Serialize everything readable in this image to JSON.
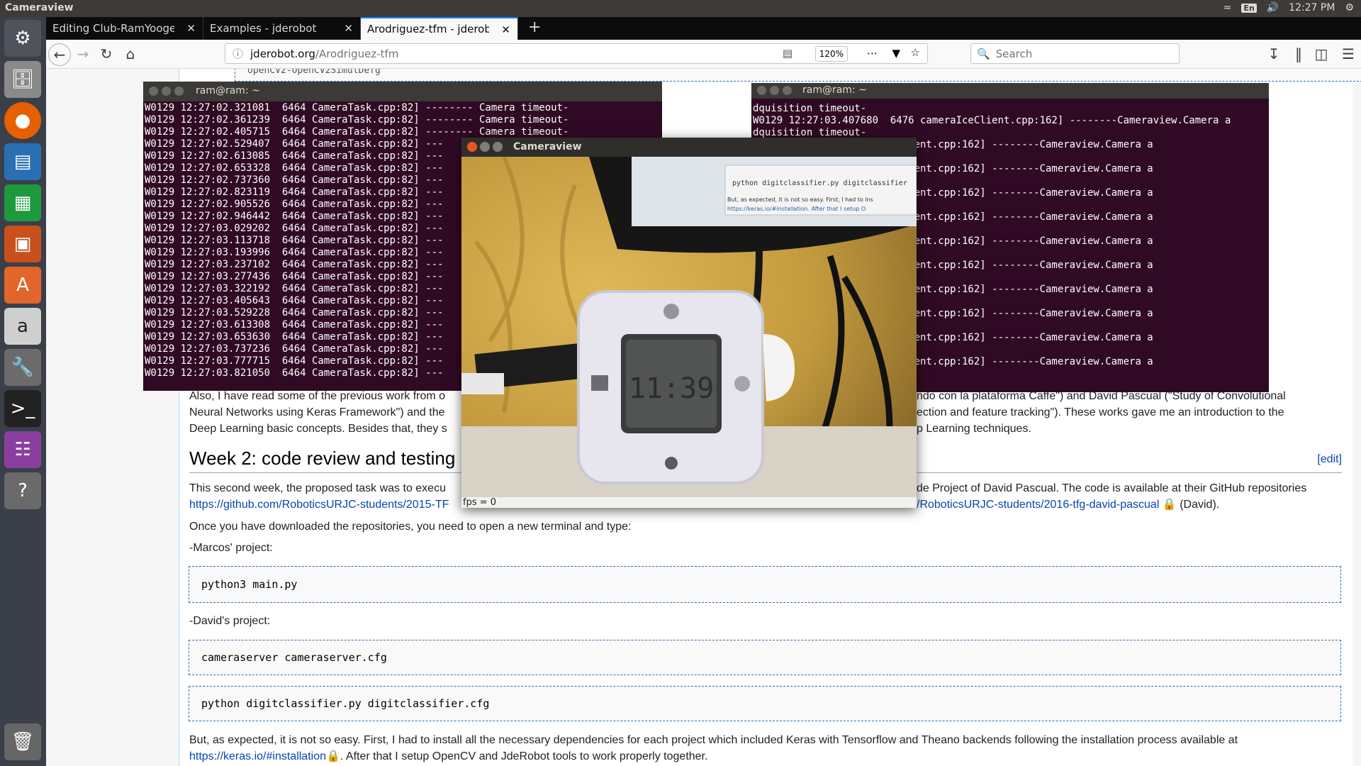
{
  "system": {
    "window_title": "Cameraview",
    "keyboard": "En",
    "clock": "12:27 PM"
  },
  "browser": {
    "tabs": [
      {
        "label": "Editing Club-RamYoogesh"
      },
      {
        "label": "Examples - jderobot"
      },
      {
        "label": "Arodriguez-tfm - jderobot"
      }
    ],
    "url_domain": "jderobot.org",
    "url_path": "/Arodriguez-tfm",
    "zoom": "120%",
    "search_placeholder": "Search"
  },
  "terminal_left": {
    "title": "ram@ram: ~",
    "lines": [
      "W0129 12:27:02.321081  6464 CameraTask.cpp:82] -------- Camera timeout-",
      "W0129 12:27:02.361239  6464 CameraTask.cpp:82] -------- Camera timeout-",
      "W0129 12:27:02.405715  6464 CameraTask.cpp:82] -------- Camera timeout-",
      "W0129 12:27:02.529407  6464 CameraTask.cpp:82] ---",
      "W0129 12:27:02.613085  6464 CameraTask.cpp:82] ---",
      "W0129 12:27:02.653328  6464 CameraTask.cpp:82] ---",
      "W0129 12:27:02.737360  6464 CameraTask.cpp:82] ---",
      "W0129 12:27:02.823119  6464 CameraTask.cpp:82] ---",
      "W0129 12:27:02.905526  6464 CameraTask.cpp:82] ---",
      "W0129 12:27:02.946442  6464 CameraTask.cpp:82] ---",
      "W0129 12:27:03.029202  6464 CameraTask.cpp:82] ---",
      "W0129 12:27:03.113718  6464 CameraTask.cpp:82] ---",
      "W0129 12:27:03.193996  6464 CameraTask.cpp:82] ---",
      "W0129 12:27:03.237102  6464 CameraTask.cpp:82] ---",
      "W0129 12:27:03.277436  6464 CameraTask.cpp:82] ---",
      "W0129 12:27:03.322192  6464 CameraTask.cpp:82] ---",
      "W0129 12:27:03.405643  6464 CameraTask.cpp:82] ---",
      "W0129 12:27:03.529228  6464 CameraTask.cpp:82] ---",
      "W0129 12:27:03.613308  6464 CameraTask.cpp:82] ---",
      "W0129 12:27:03.653630  6464 CameraTask.cpp:82] ---",
      "W0129 12:27:03.737236  6464 CameraTask.cpp:82] ---",
      "W0129 12:27:03.777715  6464 CameraTask.cpp:82] ---",
      "W0129 12:27:03.821050  6464 CameraTask.cpp:82] ---"
    ]
  },
  "terminal_right": {
    "title": "ram@ram: ~",
    "lines": [
      "dquisition timeout-",
      "W0129 12:27:03.407680  6476 cameraIceClient.cpp:162] --------Cameraview.Camera a",
      "dquisition timeout-",
      "            76 cameraIceClient.cpp:162] --------Cameraview.Camera a",
      "",
      "            76 cameraIceClient.cpp:162] --------Cameraview.Camera a",
      "",
      "            76 cameraIceClient.cpp:162] --------Cameraview.Camera a",
      "",
      "            76 cameraIceClient.cpp:162] --------Cameraview.Camera a",
      "",
      "            76 cameraIceClient.cpp:162] --------Cameraview.Camera a",
      "",
      "            76 cameraIceClient.cpp:162] --------Cameraview.Camera a",
      "",
      "            76 cameraIceClient.cpp:162] --------Cameraview.Camera a",
      "",
      "            76 cameraIceClient.cpp:162] --------Cameraview.Camera a",
      "",
      "            76 cameraIceClient.cpp:162] --------Cameraview.Camera a",
      "",
      "            76 cameraIceClient.cpp:162] --------Cameraview.Camera a"
    ]
  },
  "cameraview": {
    "title": "Cameraview",
    "fps_label": "fps = 0",
    "screen_text_1": "python digitclassifier.py digitclassifier",
    "screen_text_2": "But, as expected, it is not so easy. First, I had to ins",
    "screen_text_3": "https://keras.io/#installation. After that I setup O",
    "clock_time": "11:39"
  },
  "article": {
    "para1_visible_start": "Also, I have read some of the previous work from o",
    "para1_visible_right": "ndo con la plataforma Caffe\") and David Pascual (\"Study of Convolutional",
    "para1_line2_start": "Neural Networks using Keras Framework\") and the",
    "para1_line2_right": "ection and feature tracking\"). These works gave me an introduction to the",
    "para1_line3_start": "Deep Learning basic concepts. Besides that, they s",
    "para1_line3_right": "p Learning techniques.",
    "week2_heading": "Week 2: code review and testing",
    "edit_label": "[edit]",
    "para2_start": "This second week, the proposed task was to execu",
    "para2_right": "de Project of David Pascual. The code is available at their GitHub repositories",
    "link_marcos": "https://github.com/RoboticsURJC-students/2015-TF",
    "link_david": "/RoboticsURJC-students/2016-tfg-david-pascual",
    "david_suffix": "(David).",
    "para3": "Once you have downloaded the repositories, you need to open a new terminal and type:",
    "marcos_label": "-Marcos' project:",
    "code1": "python3 main.py",
    "david_label": "-David's project:",
    "code2": "cameraserver cameraserver.cfg",
    "code3": "python digitclassifier.py digitclassifier.cfg",
    "para4": "But, as expected, it is not so easy. First, I had to install all the necessary dependencies for each project which included Keras with Tensorflow and Theano backends following the installation process available at",
    "keras_link": "https://keras.io/#installation",
    "para4_end": ". After that I setup OpenCV and JdeRobot tools to work properly together.",
    "top_code_fragment": "openCV2-OpenCV2SimulDefg"
  }
}
